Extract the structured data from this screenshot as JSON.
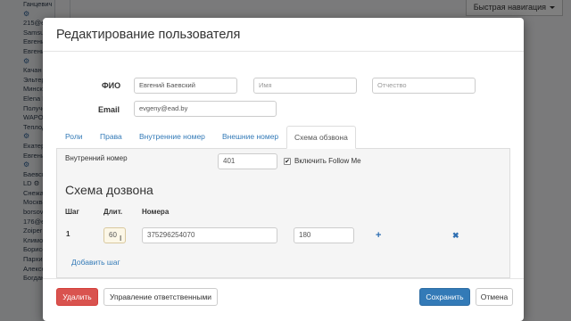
{
  "background": {
    "sidebar_rows": [
      "Ганцевич Николай",
      "⚙",
      "215@ead",
      "Samsung",
      "Евгений",
      "Евгений",
      "⚙",
      "Качан С",
      "Эльтер Е",
      "Минск С",
      "Elena K",
      "Получен",
      "WAPO1",
      "Теплодар",
      "⚙",
      "Екатери",
      "Евгений",
      "⚙",
      "Баевский",
      "LD ⚙",
      "Снежана",
      "Москва",
      "borsov",
      "176@ead",
      "Zoiper 10",
      "Климов",
      "Борисов",
      "Пархимо",
      "Алексей",
      "Богданская Алексей"
    ],
    "quick_nav_label": "Быстрая навигация"
  },
  "modal": {
    "title": "Редактирование пользователя",
    "fio_label": "ФИО",
    "last_name_value": "Евгений Баевский",
    "first_name_placeholder": "Имя",
    "patronymic_placeholder": "Отчество",
    "email_label": "Email",
    "email_value": "evgeny@ead.by",
    "tabs": [
      "Роли",
      "Права",
      "Внутренние номер",
      "Внешние номер",
      "Схема обзвона"
    ],
    "active_tab": "Схема обзвона",
    "internal_number_label": "Внутренний номер",
    "internal_number_value": "401",
    "follow_me_label": "Включить Follow Me",
    "follow_me_checked": true,
    "checkbox_glyph": "✔",
    "section_title": "Схема дозвона",
    "step_header": "Шаг",
    "duration_header": "Длит.",
    "numbers_header": "Номера",
    "row_step": "1",
    "row_duration": "60",
    "row_number": "375296254070",
    "row_timeout": "180",
    "add_icon_glyph": "+",
    "remove_icon_glyph": "✖",
    "add_step_link": "Добавить шаг",
    "cursor_glyph": "I",
    "footer": {
      "delete_label": "Удалить",
      "manage_responsible_label": "Управление ответственными",
      "save_label": "Сохранить",
      "cancel_label": "Отмена"
    }
  },
  "colors": {
    "primary": "#337ab7",
    "danger": "#d9534f",
    "link": "#337ab7",
    "icon_blue": "#2f6fb2"
  }
}
